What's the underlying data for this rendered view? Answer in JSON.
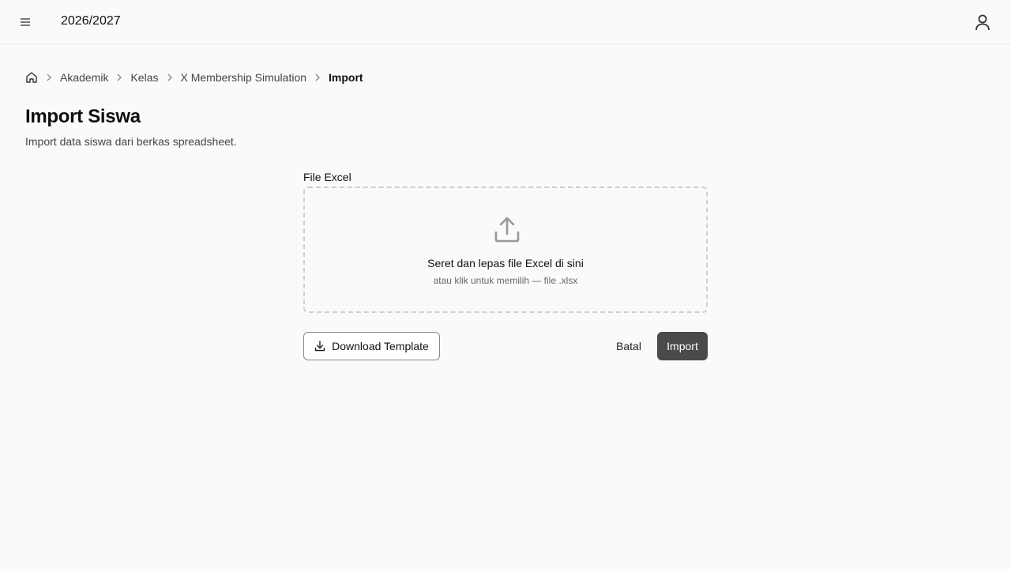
{
  "topbar": {
    "menu_icon": "hamburger-menu-icon",
    "year": "2026/2027",
    "user_icon": "user-icon"
  },
  "breadcrumb": {
    "home_icon": "home-icon",
    "items": [
      {
        "label": "Akademik"
      },
      {
        "label": "Kelas"
      },
      {
        "label": "X Membership Simulation"
      },
      {
        "label": "Import"
      }
    ]
  },
  "page": {
    "title": "Import Siswa",
    "subtitle": "Import data siswa dari berkas spreadsheet."
  },
  "form": {
    "field_label": "File Excel",
    "dropzone": {
      "icon": "upload-icon",
      "title": "Seret dan lepas file Excel di sini",
      "hint": "atau klik untuk memilih — file .xlsx"
    },
    "download_label": "Download Template",
    "cancel_label": "Batal",
    "import_label": "Import"
  },
  "colors": {
    "primary_button": "#4a4a4a",
    "border": "#cfcfcf",
    "background": "#fafafa"
  }
}
